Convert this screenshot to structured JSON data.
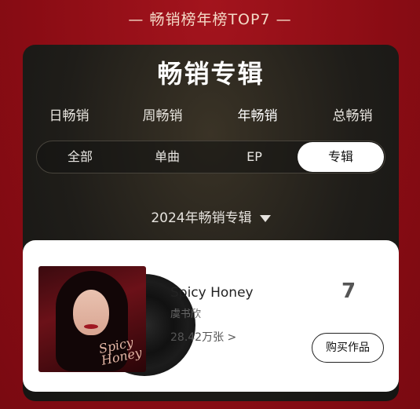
{
  "banner": "— 畅销榜年榜TOP7 —",
  "panel": {
    "title": "畅销专辑"
  },
  "period_tabs": [
    "日畅销",
    "周畅销",
    "年畅销",
    "总畅销"
  ],
  "period_active": "年畅销",
  "type_tabs": [
    "全部",
    "单曲",
    "EP",
    "专辑"
  ],
  "type_active": "专辑",
  "year_select": {
    "label": "2024年畅销专辑"
  },
  "album": {
    "title": "Spicy Honey",
    "artist": "虞书欣",
    "sales": "28.42万张 >",
    "rank": "7",
    "buy_label": "购买作品",
    "cover_script": "Spicy Honey"
  },
  "colors": {
    "background": "#8f0e16",
    "panel": "#1f1d19",
    "card": "#ffffff"
  }
}
